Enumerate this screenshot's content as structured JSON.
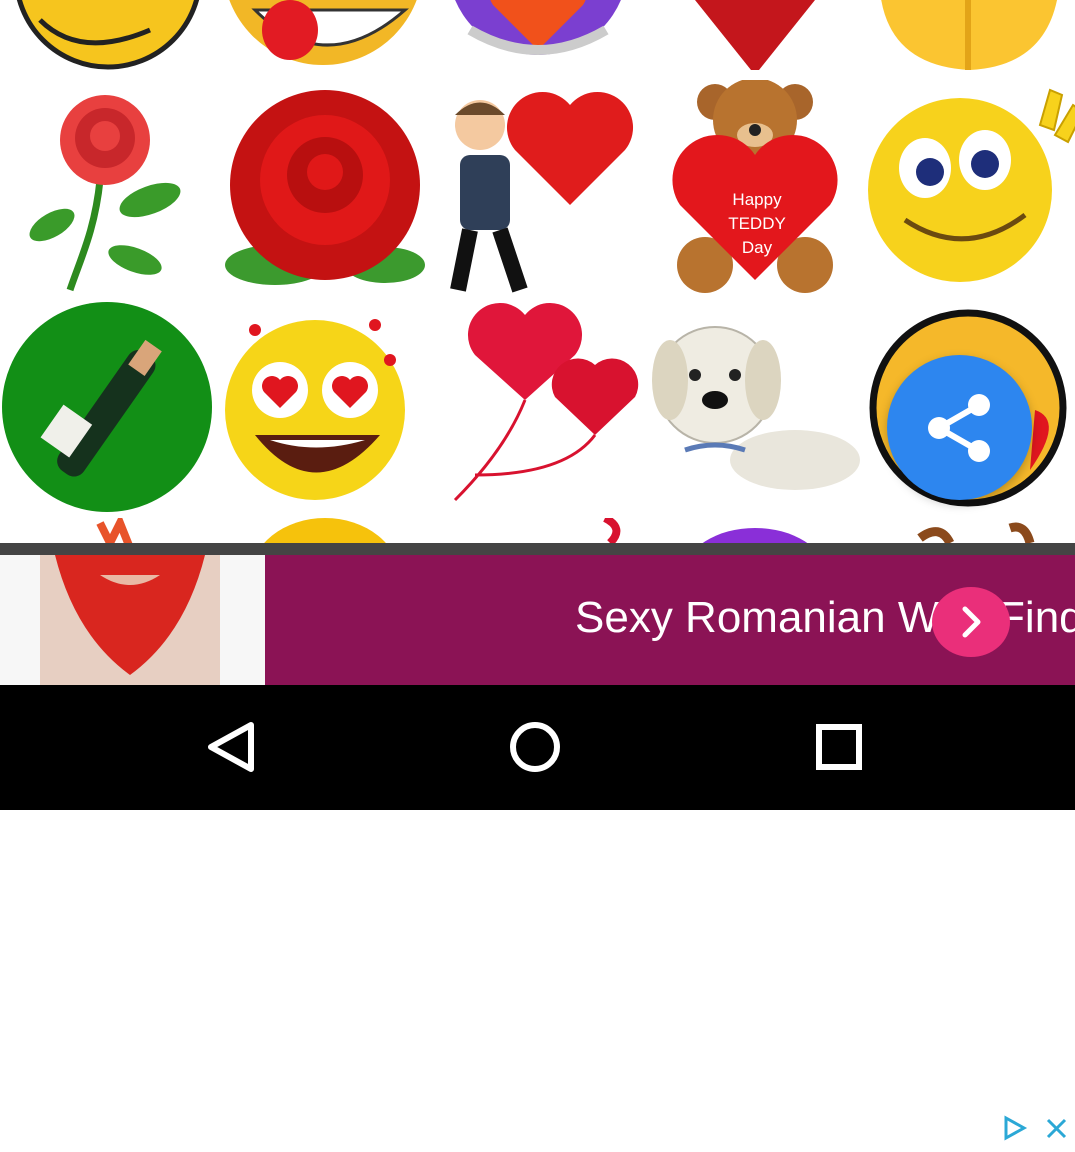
{
  "grid": {
    "items": [
      {
        "name": "emoji-hands"
      },
      {
        "name": "emoji-tongue"
      },
      {
        "name": "heart-hands"
      },
      {
        "name": "red-heart"
      },
      {
        "name": "clapping-hands"
      },
      {
        "name": "red-rose"
      },
      {
        "name": "big-red-rose"
      },
      {
        "name": "man-hug-heart"
      },
      {
        "name": "teddy-heart",
        "text": [
          "Happy",
          "TEDDY",
          "Day"
        ]
      },
      {
        "name": "peace-smiley"
      },
      {
        "name": "champagne"
      },
      {
        "name": "heart-eyes-smiley"
      },
      {
        "name": "heart-balloons"
      },
      {
        "name": "puppy"
      },
      {
        "name": "kiss-smiley"
      }
    ]
  },
  "fab": {
    "icon": "share-icon"
  },
  "ad": {
    "text": "Sexy Romanian Wife Finder",
    "arrow_icon": "chevron-right-icon",
    "choice_icon": "adchoices-icon",
    "close_icon": "close-icon",
    "accent": "#8b1355"
  },
  "navbar": {
    "back_icon": "back-icon",
    "home_icon": "home-icon",
    "recents_icon": "recents-icon"
  }
}
